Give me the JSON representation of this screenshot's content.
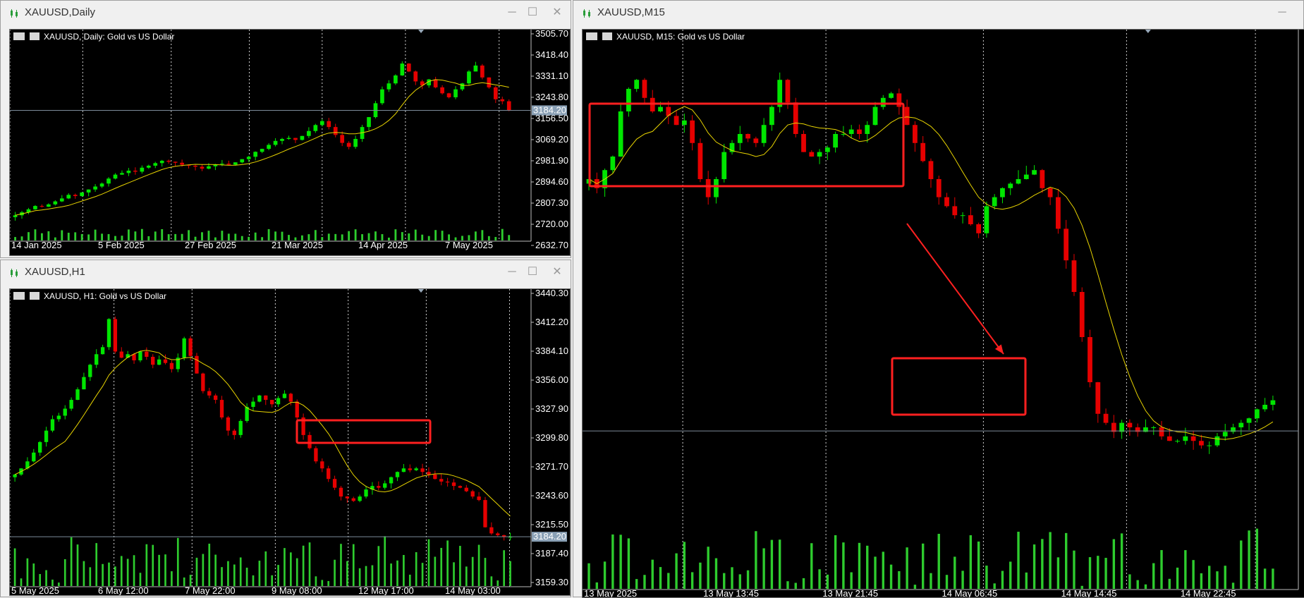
{
  "windows": {
    "daily": {
      "title": "XAUUSD,Daily",
      "header": "XAUUSD, Daily:  Gold vs US Dollar"
    },
    "h1": {
      "title": "XAUUSD,H1",
      "header": "XAUUSD, H1:  Gold vs US Dollar"
    },
    "m15": {
      "title": "XAUUSD,M15",
      "header": "XAUUSD, M15:  Gold vs US Dollar"
    }
  },
  "controls": {
    "minimize": "─",
    "maximize": "☐",
    "close": "✕"
  },
  "colors": {
    "bull": "#00e600",
    "bear": "#e60000",
    "ma": "#e8d400",
    "volume": "#2ecc2e",
    "annotation": "#ff2020",
    "background": "#000000"
  },
  "chart_data": [
    {
      "id": "daily",
      "type": "candlestick",
      "title": "XAUUSD, Daily:  Gold vs US Dollar",
      "y_ticks": [
        "3505.70",
        "3418.40",
        "3331.10",
        "3243.80",
        "3156.50",
        "3069.20",
        "2981.90",
        "2894.60",
        "2807.30",
        "2720.00",
        "2632.70"
      ],
      "x_ticks": [
        "14 Jan 2025",
        "5 Feb 2025",
        "27 Feb 2025",
        "21 Mar 2025",
        "14 Apr 2025",
        "7 May 2025"
      ],
      "ylim": [
        2560,
        3520
      ],
      "current_price": "3184.20",
      "ma_line": true,
      "volume": true,
      "closes": [
        2655,
        2670,
        2685,
        2702,
        2698,
        2710,
        2725,
        2740,
        2758,
        2752,
        2770,
        2785,
        2800,
        2815,
        2840,
        2860,
        2868,
        2880,
        2875,
        2895,
        2905,
        2918,
        2930,
        2925,
        2920,
        2910,
        2905,
        2900,
        2890,
        2902,
        2912,
        2915,
        2910,
        2922,
        2938,
        2950,
        2975,
        2990,
        3010,
        3030,
        3040,
        3045,
        3035,
        3055,
        3080,
        3110,
        3130,
        3100,
        3060,
        3020,
        3000,
        3040,
        3100,
        3150,
        3220,
        3290,
        3320,
        3360,
        3420,
        3380,
        3330,
        3310,
        3340,
        3300,
        3270,
        3250,
        3290,
        3320,
        3380,
        3410,
        3350,
        3300,
        3240,
        3230,
        3184
      ]
    },
    {
      "id": "h1",
      "type": "candlestick",
      "title": "XAUUSD, H1:  Gold vs US Dollar",
      "y_ticks": [
        "3440.30",
        "3412.20",
        "3384.10",
        "3356.00",
        "3327.90",
        "3299.80",
        "3271.70",
        "3243.60",
        "3215.50",
        "3187.40",
        "3159.30"
      ],
      "x_ticks": [
        "5 May 2025",
        "6 May 12:00",
        "7 May 22:00",
        "9 May 08:00",
        "12 May 17:00",
        "14 May 03:00"
      ],
      "ylim": [
        3145,
        3450
      ],
      "current_price": "3184.20",
      "ma_line": true,
      "volume": true,
      "closes": [
        3255,
        3262,
        3270,
        3280,
        3292,
        3305,
        3318,
        3322,
        3330,
        3340,
        3352,
        3366,
        3380,
        3392,
        3400,
        3432,
        3395,
        3388,
        3392,
        3385,
        3395,
        3389,
        3380,
        3386,
        3382,
        3375,
        3388,
        3410,
        3390,
        3370,
        3350,
        3345,
        3340,
        3320,
        3305,
        3300,
        3316,
        3332,
        3338,
        3345,
        3340,
        3335,
        3342,
        3347,
        3338,
        3320,
        3300,
        3285,
        3270,
        3262,
        3250,
        3240,
        3230,
        3228,
        3225,
        3230,
        3238,
        3242,
        3240,
        3245,
        3252,
        3258,
        3262,
        3260,
        3262,
        3258,
        3255,
        3250,
        3247,
        3246,
        3242,
        3240,
        3236,
        3230,
        3226,
        3195,
        3188,
        3186,
        3184,
        3184
      ]
    },
    {
      "id": "m15",
      "type": "candlestick",
      "title": "XAUUSD, M15:  Gold vs US Dollar",
      "y_ticks": [],
      "x_ticks": [
        "13 May 2025",
        "13 May 13:45",
        "13 May 21:45",
        "14 May 06:45",
        "14 May 14:45",
        "14 May 22:45"
      ],
      "ylim": [
        3170,
        3270
      ],
      "current_price": "3184.20",
      "ma_line": true,
      "volume": true,
      "closes": [
        3240,
        3238,
        3242,
        3245,
        3255,
        3260,
        3262,
        3258,
        3255,
        3256,
        3254,
        3252,
        3253,
        3248,
        3240,
        3236,
        3240,
        3246,
        3248,
        3250,
        3249,
        3248,
        3252,
        3256,
        3262,
        3257,
        3250,
        3246,
        3245,
        3246,
        3247,
        3250,
        3250,
        3251,
        3250,
        3252,
        3256,
        3258,
        3259,
        3256,
        3252,
        3248,
        3244,
        3240,
        3236,
        3234,
        3232,
        3232,
        3230,
        3228,
        3234,
        3236,
        3238,
        3239,
        3240,
        3241,
        3242,
        3238,
        3236,
        3229,
        3222,
        3215,
        3205,
        3195,
        3188,
        3186,
        3184,
        3186,
        3185,
        3184,
        3185,
        3185,
        3183,
        3182,
        3182,
        3183,
        3182,
        3181,
        3181,
        3183,
        3184,
        3185,
        3186,
        3187,
        3189,
        3190,
        3191
      ]
    }
  ]
}
